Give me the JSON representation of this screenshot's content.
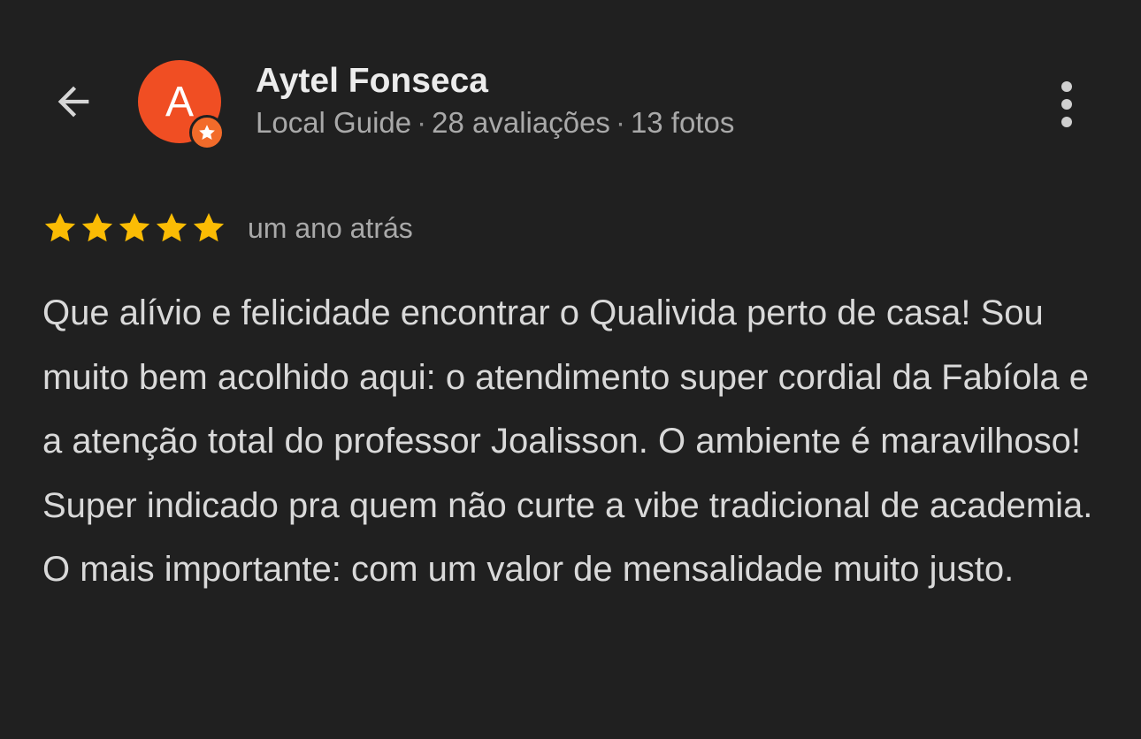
{
  "header": {
    "back_icon": "arrow-left-icon",
    "avatar_letter": "A",
    "avatar_color": "#f04e23",
    "avatar_badge_icon": "star-icon",
    "user_name": "Aytel Fonseca",
    "meta": {
      "badge": "Local Guide",
      "separator": "·",
      "reviews": "28 avaliações",
      "photos": "13 fotos"
    },
    "more_icon": "more-vertical-icon"
  },
  "review": {
    "rating": 5,
    "max_rating": 5,
    "star_color": "#fbbc04",
    "time": "um ano atrás",
    "text": "Que alívio e felicidade encontrar o Qualivida perto de casa! Sou muito bem acolhido aqui: o atendimento super cordial da Fabíola e a atenção total do professor Joalisson. O ambiente é maravilhoso! Super indicado pra quem não curte a vibe tradicional de academia. O mais importante: com um valor de mensalidade muito justo."
  }
}
